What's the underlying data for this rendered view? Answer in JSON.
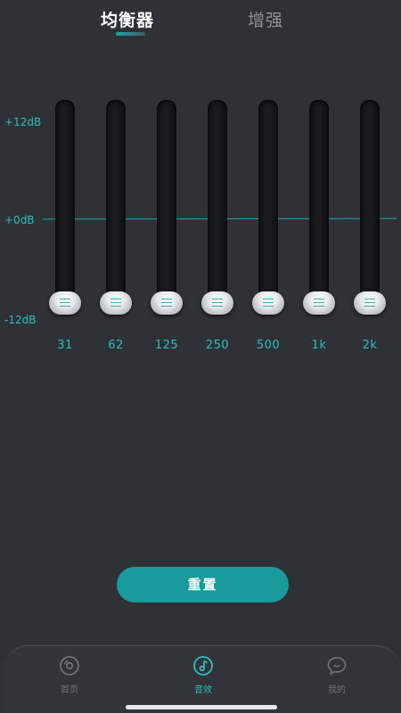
{
  "tabs": {
    "equalizer": "均衡器",
    "enhance": "增强",
    "active": "equalizer"
  },
  "equalizer": {
    "db_labels": {
      "top": "+12dB",
      "middle": "+0dB",
      "bottom": "-12dB"
    },
    "bands": [
      {
        "freq": "31",
        "gain_db": -12
      },
      {
        "freq": "62",
        "gain_db": -12
      },
      {
        "freq": "125",
        "gain_db": -12
      },
      {
        "freq": "250",
        "gain_db": -12
      },
      {
        "freq": "500",
        "gain_db": -12
      },
      {
        "freq": "1k",
        "gain_db": -12
      },
      {
        "freq": "2k",
        "gain_db": -12
      }
    ]
  },
  "reset_label": "重置",
  "nav": {
    "items": [
      {
        "label": "首页",
        "icon": "disc-icon",
        "active": false
      },
      {
        "label": "音效",
        "icon": "music-note-icon",
        "active": true
      },
      {
        "label": "我的",
        "icon": "chat-bubble-icon",
        "active": false
      }
    ]
  },
  "colors": {
    "background": "#2e3237",
    "accent": "#1a9b9b",
    "accent_text": "#2cbcbc",
    "inactive": "#6d7278"
  }
}
